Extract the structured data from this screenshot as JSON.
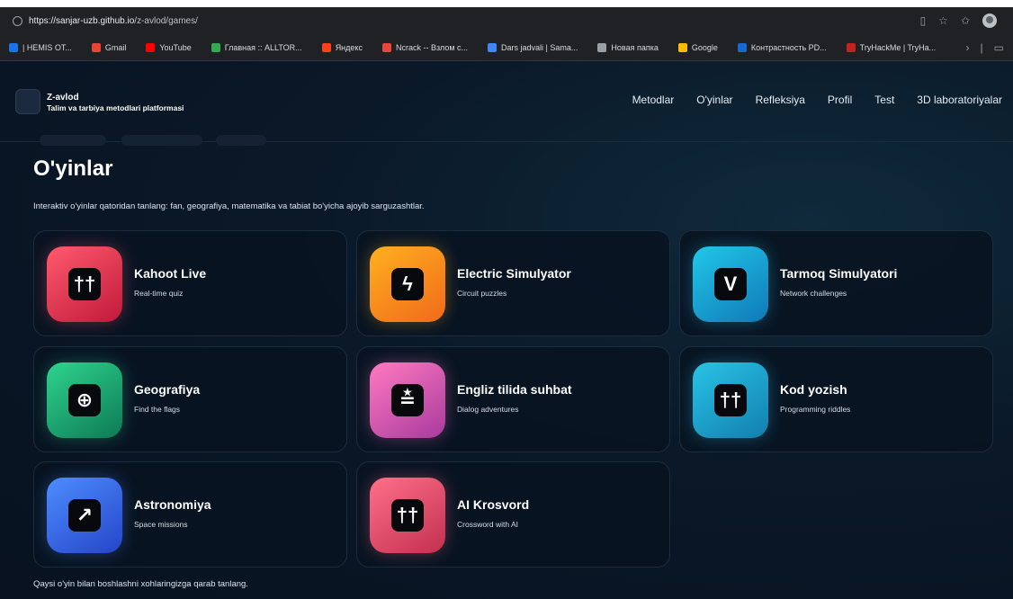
{
  "browser": {
    "url_host": "https://sanjar-uzb.github.io",
    "url_path": "/z-avlod/games/",
    "bookmarks": [
      {
        "label": "| HEMIS OT...",
        "color": "#1a73e8"
      },
      {
        "label": "Gmail",
        "color": "#ea4335"
      },
      {
        "label": "YouTube",
        "color": "#ff0000"
      },
      {
        "label": "Главная :: ALLTOR...",
        "color": "#34a853"
      },
      {
        "label": "Яндекс",
        "color": "#fc3f1d"
      },
      {
        "label": "Ncrack -- Взлом с...",
        "color": "#e8453c"
      },
      {
        "label": "Dars jadvali | Sama...",
        "color": "#4285f4"
      },
      {
        "label": "Новая папка",
        "color": "#9aa0a6"
      },
      {
        "label": "Google",
        "color": "#fbbc05"
      },
      {
        "label": "Контрастность PD...",
        "color": "#1967d2"
      },
      {
        "label": "TryHackMe | TryHa...",
        "color": "#c5221f"
      }
    ]
  },
  "brand": {
    "name": "Z-avlod",
    "subtitle": "Talim va tarbiya metodlari platformasi"
  },
  "nav": [
    "Metodlar",
    "O'yinlar",
    "Refleksiya",
    "Profil",
    "Test",
    "3D laboratoriyalar"
  ],
  "page": {
    "title": "O'yinlar",
    "subtitle": "Interaktiv o'yinlar qatoridan tanlang: fan, geografiya, matematika va tabiat bo'yicha ajoyib sarguzashtlar.",
    "footer": "Qaysi o'yin bilan boshlashni xohlaringizga qarab tanlang."
  },
  "games": [
    {
      "title": "Kahoot Live",
      "subtitle": "Real-time quiz",
      "icon": "dagger-icon",
      "glyph": "††",
      "gradient": [
        "#ff5a6e",
        "#c01a3a"
      ]
    },
    {
      "title": "Electric Simulyator",
      "subtitle": "Circuit puzzles",
      "icon": "lightning-icon",
      "glyph": "ϟ",
      "gradient": [
        "#ffb020",
        "#f06a1a"
      ]
    },
    {
      "title": "Tarmoq Simulyatori",
      "subtitle": "Network challenges",
      "icon": "network-icon",
      "glyph": "V",
      "gradient": [
        "#22c7e8",
        "#0f79b8"
      ]
    },
    {
      "title": "Geografiya",
      "subtitle": "Find the flags",
      "icon": "globe-icon",
      "glyph": "⊕",
      "gradient": [
        "#2fd48e",
        "#0d7a55"
      ]
    },
    {
      "title": "Engliz tilida suhbat",
      "subtitle": "Dialog adventures",
      "icon": "dialog-icon",
      "glyph": "≛",
      "gradient": [
        "#ff7ac0",
        "#a83a9e"
      ]
    },
    {
      "title": "Kod yozish",
      "subtitle": "Programming riddles",
      "icon": "code-icon",
      "glyph": "††",
      "gradient": [
        "#29c3e6",
        "#127fae"
      ]
    },
    {
      "title": "Astronomiya",
      "subtitle": "Space missions",
      "icon": "rocket-icon",
      "glyph": "↗",
      "gradient": [
        "#4d8dff",
        "#2545c8"
      ]
    },
    {
      "title": "AI Krosvord",
      "subtitle": "Crossword with AI",
      "icon": "crossword-icon",
      "glyph": "††",
      "gradient": [
        "#ff6f8a",
        "#c2304f"
      ]
    }
  ]
}
